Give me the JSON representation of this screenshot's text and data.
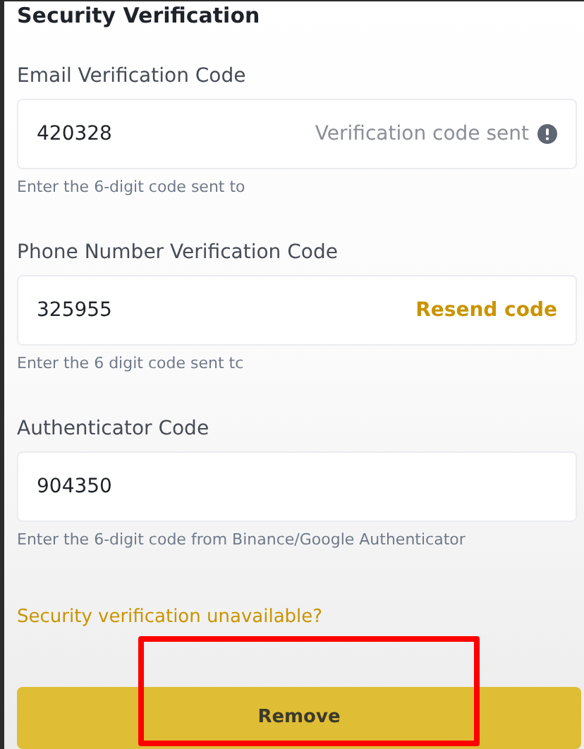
{
  "title": "Security Verification",
  "fields": [
    {
      "label": "Email Verification Code",
      "value": "420328",
      "suffix": {
        "kind": "status",
        "text": "Verification code sent"
      },
      "helper": "Enter the 6-digit code sent to"
    },
    {
      "label": "Phone Number Verification Code",
      "value": "325955",
      "suffix": {
        "kind": "link",
        "text": "Resend code"
      },
      "helper": "Enter the 6 digit code sent tc"
    },
    {
      "label": "Authenticator Code",
      "value": "904350",
      "helper": "Enter the 6-digit code from Binance/Google Authenticator"
    }
  ],
  "help_link": "Security verification unavailable?",
  "button": {
    "label": "Remove"
  },
  "annotation": {
    "kind": "frame"
  }
}
